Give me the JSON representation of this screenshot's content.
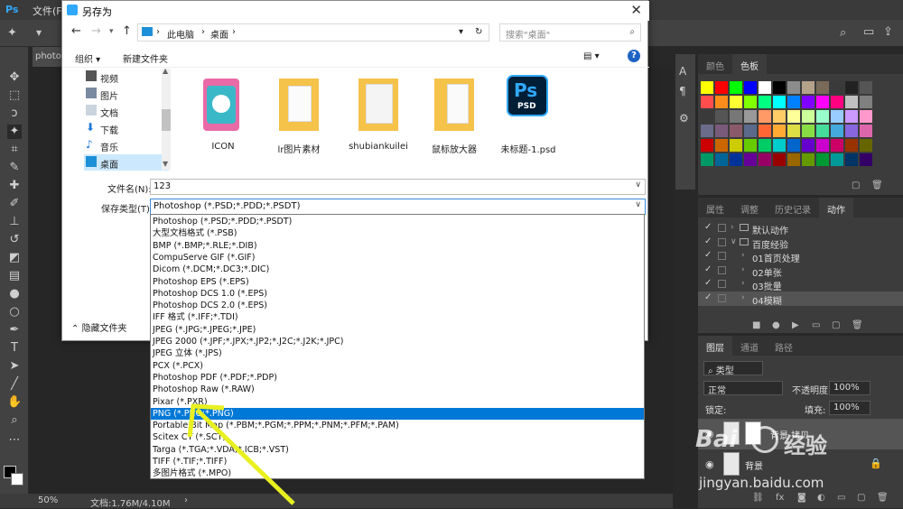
{
  "ps": {
    "menus": [
      "文件(F)"
    ],
    "doc_tab": "photo-",
    "zoom": "50%",
    "doc_info": "文档:1.76M/4.10M",
    "swatch_panel_tabs": [
      "颜色",
      "色板"
    ],
    "action_panel_tabs": [
      "属性",
      "调整",
      "历史记录",
      "动作"
    ],
    "actions": [
      {
        "label": "默认动作",
        "level": 0,
        "expanded": false
      },
      {
        "label": "百度经验",
        "level": 0,
        "expanded": true
      },
      {
        "label": "01首页处理",
        "level": 1
      },
      {
        "label": "02单张",
        "level": 1
      },
      {
        "label": "03批量",
        "level": 1
      },
      {
        "label": "04模糊",
        "level": 1,
        "selected": true
      }
    ],
    "layer_panel_tabs": [
      "图层",
      "通道",
      "路径"
    ],
    "layer_filter": "类型",
    "blend_mode": "正常",
    "opacity_label": "不透明度:",
    "opacity_value": "100%",
    "lock_label": "锁定:",
    "fill_label": "填充:",
    "fill_value": "100%",
    "layers": [
      "背景 拷贝",
      "背景"
    ],
    "swatch_rows": [
      [
        "#ffff00",
        "#ff0000",
        "#00ff00",
        "#0000ff",
        "#ffffff",
        "#000000",
        "#8c8c8c",
        "#b5a28a",
        "#7a6a5a",
        "#3a3a3a",
        "#222222",
        "#555555"
      ],
      [
        "#ff4d4d",
        "#ff8c1a",
        "#ffff33",
        "#80ff00",
        "#00ff80",
        "#00ffff",
        "#0080ff",
        "#8000ff",
        "#ff00ff",
        "#ff0080",
        "#c0c0c0",
        "#808080"
      ],
      [
        "#3a3a3a",
        "#555555",
        "#777777",
        "#999999",
        "#ff9966",
        "#ffcc66",
        "#ffff99",
        "#ccff99",
        "#99ffcc",
        "#99ccff",
        "#cc99ff",
        "#ff99cc"
      ],
      [
        "#6b6b8a",
        "#7a5a7a",
        "#8a5a6a",
        "#5a6a8a",
        "#ff6633",
        "#ffaa33",
        "#dddd44",
        "#88dd44",
        "#44dd99",
        "#44aadd",
        "#8866dd",
        "#dd66aa"
      ],
      [
        "#cc0000",
        "#cc6600",
        "#cccc00",
        "#66cc00",
        "#00cc66",
        "#00cccc",
        "#0066cc",
        "#6600cc",
        "#cc00cc",
        "#cc0066",
        "#993300",
        "#666600"
      ],
      [
        "#009966",
        "#006699",
        "#003399",
        "#660099",
        "#990066",
        "#990000",
        "#996600",
        "#669900",
        "#009933",
        "#009999",
        "#003366",
        "#330066"
      ]
    ]
  },
  "dialog": {
    "title": "另存为",
    "address": [
      "此电脑",
      "桌面"
    ],
    "search_placeholder": "搜索\"桌面\"",
    "organize": "组织 ▾",
    "new_folder": "新建文件夹",
    "nav_items": [
      "视频",
      "图片",
      "文档",
      "下载",
      "音乐",
      "桌面"
    ],
    "files": [
      "ICON",
      "lr图片素材",
      "shubiankuilei",
      "鼠标放大器",
      "未标题-1.psd"
    ],
    "psd_icon_text": "Ps",
    "psd_icon_sub": "PSD",
    "filename_label": "文件名(N):",
    "filename_value": "123",
    "filetype_label": "保存类型(T):",
    "filetype_value": "Photoshop (*.PSD;*.PDD;*.PSDT)",
    "hide_folders": "隐藏文件夹"
  },
  "dropdown": {
    "options": [
      "Photoshop (*.PSD;*.PDD;*.PSDT)",
      "大型文档格式 (*.PSB)",
      "BMP (*.BMP;*.RLE;*.DIB)",
      "CompuServe GIF (*.GIF)",
      "Dicom (*.DCM;*.DC3;*.DIC)",
      "Photoshop EPS (*.EPS)",
      "Photoshop DCS 1.0 (*.EPS)",
      "Photoshop DCS 2.0 (*.EPS)",
      "IFF 格式 (*.IFF;*.TDI)",
      "JPEG (*.JPG;*.JPEG;*.JPE)",
      "JPEG 2000 (*.JPF;*.JPX;*.JP2;*.J2C;*.J2K;*.JPC)",
      "JPEG 立体 (*.JPS)",
      "PCX (*.PCX)",
      "Photoshop PDF (*.PDF;*.PDP)",
      "Photoshop Raw (*.RAW)",
      "Pixar (*.PXR)",
      "PNG (*.PNG;*.PNG)",
      "Portable Bit Map (*.PBM;*.PGM;*.PPM;*.PNM;*.PFM;*.PAM)",
      "Scitex CT (*.SCT)",
      "Targa (*.TGA;*.VDA;*.ICB;*.VST)",
      "TIFF (*.TIF;*.TIFF)",
      "多图片格式 (*.MPO)"
    ],
    "selected_index": 16
  },
  "watermark": {
    "brand": "Bai",
    "brand2": "经验",
    "url": "jingyan.baidu.com"
  },
  "colors": {
    "accent": "#0078d7",
    "annotation": "#e8f020",
    "ps_blue": "#31a8ff"
  }
}
